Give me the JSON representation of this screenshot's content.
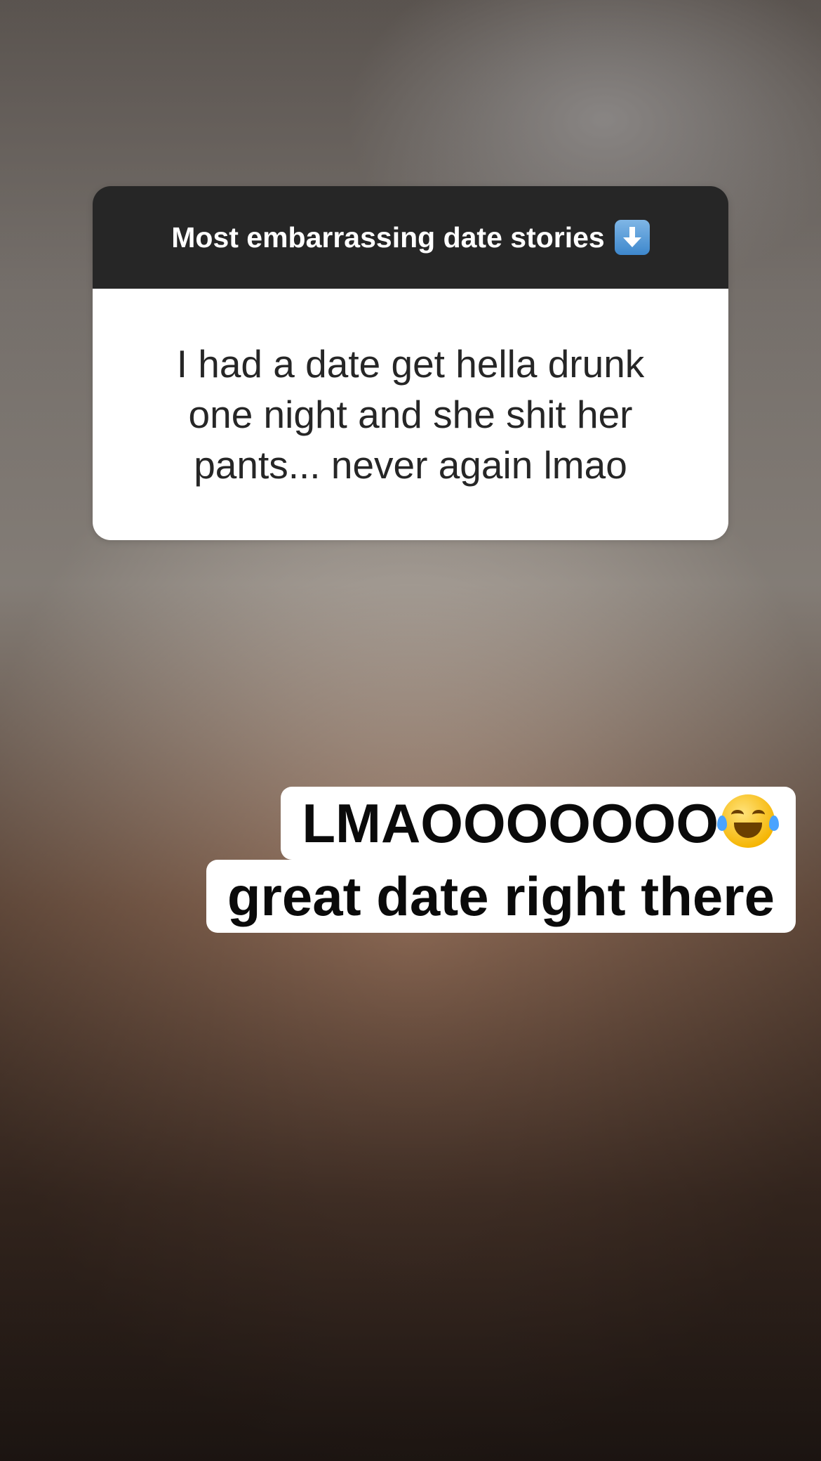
{
  "question_card": {
    "header": "Most embarrassing date stories",
    "header_icon": "down-arrow-emoji-icon",
    "answer": "I had a date get hella drunk one night and she shit her pants... never again lmao"
  },
  "caption": {
    "line1": "LMAOOOOOOO",
    "line1_emoji": "tears-of-joy-emoji-icon",
    "line2": "great date right there"
  },
  "colors": {
    "card_header_bg": "#262626",
    "card_body_bg": "#ffffff",
    "caption_bg": "#ffffff"
  }
}
